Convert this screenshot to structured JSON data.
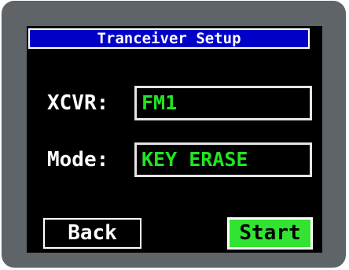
{
  "window": {
    "title": "Tranceiver Setup"
  },
  "form": {
    "xcvr": {
      "label": "XCVR:",
      "value": "FM1"
    },
    "mode": {
      "label": "Mode:",
      "value": "KEY ERASE"
    }
  },
  "buttons": {
    "back_label": "Back",
    "start_label": "Start"
  },
  "colors": {
    "title_bar": "#0000c8",
    "field_text": "#22e322",
    "start_button": "#32e332",
    "screen_background": "#000000",
    "bezel": "#5e6468"
  }
}
